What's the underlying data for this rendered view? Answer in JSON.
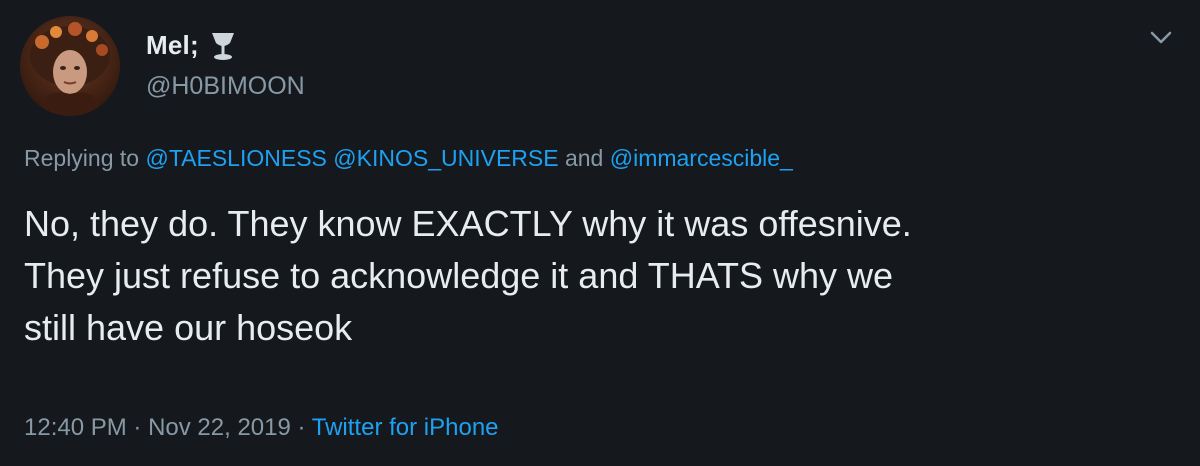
{
  "tweet": {
    "display_name": "Mel;",
    "handle": "@H0BIMOON",
    "reply_prefix": "Replying to",
    "mentions": [
      "@TAESLIONESS",
      "@KINOS_UNIVERSE",
      "@immarcescible_"
    ],
    "reply_and": "and",
    "text_lines": [
      "No, they do. They know EXACTLY why it was offesnive.",
      "They just refuse to acknowledge it and THATS why we",
      "still have our hoseok"
    ],
    "time": "12:40 PM",
    "date": "Nov 22, 2019",
    "separator": "·",
    "source": "Twitter for iPhone"
  },
  "icons": {
    "name_emoji": "goblet-emoji-icon",
    "menu": "chevron-down-icon"
  },
  "colors": {
    "background": "#15181c",
    "text_primary": "#e6ecf0",
    "text_secondary": "#8899a6",
    "link": "#1da1f2"
  }
}
